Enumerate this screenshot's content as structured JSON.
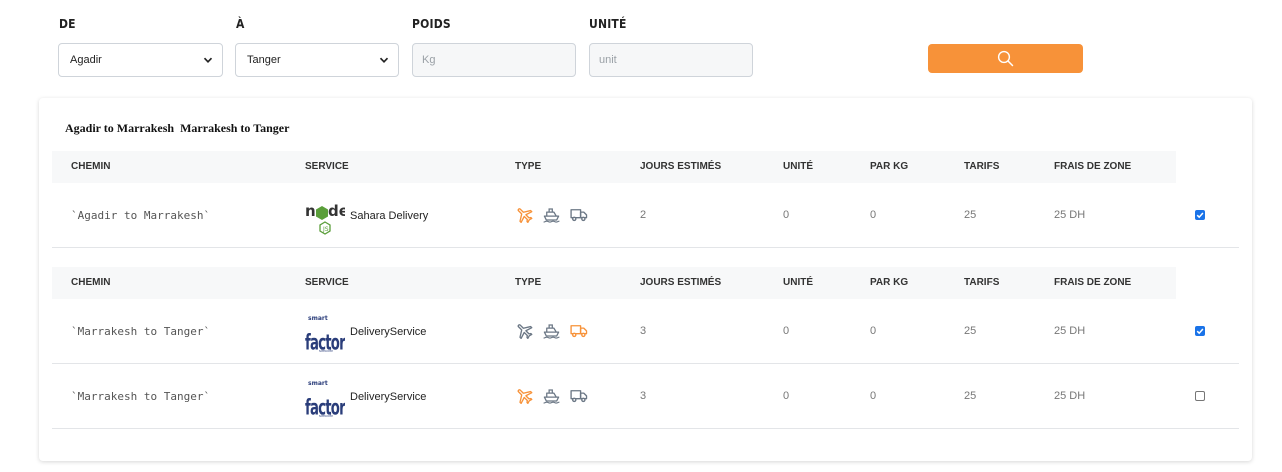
{
  "filters": {
    "from": {
      "label": "DE",
      "value": "Agadir"
    },
    "to": {
      "label": "À",
      "value": "Tanger"
    },
    "weight": {
      "label": "POIDS",
      "placeholder": "Kg"
    },
    "unit": {
      "label": "UNITÉ",
      "placeholder": "unit"
    },
    "search_icon": "search-icon",
    "accent_color": "#f79239"
  },
  "results": {
    "route_title": "Agadir to Marrakesh  Marrakesh to Tanger",
    "columns": [
      "CHEMIN",
      "SERVICE",
      "TYPE",
      "JOURS ESTIMÉS",
      "UNITÉ",
      "PAR KG",
      "TARIFS",
      "FRAIS DE ZONE"
    ],
    "groups": [
      {
        "columns": [
          "CHEMIN",
          "SERVICE",
          "TYPE",
          "JOURS ESTIMÉS",
          "UNITÉ",
          "PAR KG",
          "TARIFS",
          "FRAIS DE ZONE"
        ],
        "rows": [
          {
            "path": "`Agadir to Marrakesh`",
            "service": "Sahara Delivery",
            "logo": "node-logo",
            "active_type": "plane",
            "days": "2",
            "unit": "0",
            "per_kg": "0",
            "tarif": "25",
            "zone_fee": "25 DH",
            "checked": true
          }
        ]
      },
      {
        "columns": [
          "CHEMIN",
          "SERVICE",
          "TYPE",
          "JOURS ESTIMÉS",
          "UNITÉ",
          "PAR KG",
          "TARIFS",
          "FRAIS DE ZONE"
        ],
        "rows": [
          {
            "path": "`Marrakesh to Tanger`",
            "service": "DeliveryService",
            "logo": "factory-logo",
            "active_type": "truck",
            "days": "3",
            "unit": "0",
            "per_kg": "0",
            "tarif": "25",
            "zone_fee": "25 DH",
            "checked": true
          },
          {
            "path": "`Marrakesh to Tanger`",
            "service": "DeliveryService",
            "logo": "factory-logo",
            "active_type": "plane",
            "days": "3",
            "unit": "0",
            "per_kg": "0",
            "tarif": "25",
            "zone_fee": "25 DH",
            "checked": false
          }
        ]
      }
    ],
    "colors": {
      "active_icon": "#f79239",
      "inactive_icon": "#6b7785",
      "checkbox": "#1a73e8"
    }
  }
}
